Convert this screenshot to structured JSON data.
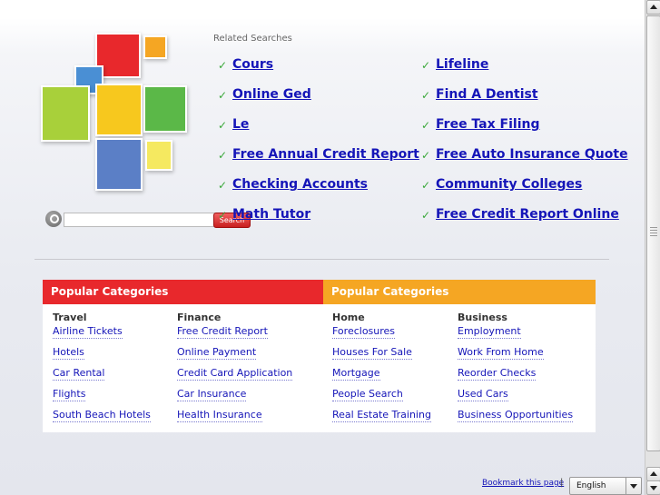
{
  "related": {
    "title": "Related Searches",
    "left": [
      "Cours",
      "Online Ged",
      "Le",
      "Free Annual Credit Report",
      "Checking Accounts",
      "Math Tutor"
    ],
    "right": [
      "Lifeline",
      "Find A Dentist",
      "Free Tax Filing",
      "Free Auto Insurance Quote",
      "Community Colleges",
      "Free Credit Report Online"
    ]
  },
  "search": {
    "button_label": "Search",
    "value": ""
  },
  "categories": [
    {
      "header": "Popular Categories",
      "color": "#e8282c",
      "columns": [
        {
          "title": "Travel",
          "links": [
            "Airline Tickets",
            "Hotels",
            "Car Rental",
            "Flights",
            "South Beach Hotels"
          ]
        },
        {
          "title": "Finance",
          "links": [
            "Free Credit Report",
            "Online Payment",
            "Credit Card Application",
            "Car Insurance",
            "Health Insurance"
          ]
        }
      ]
    },
    {
      "header": "Popular Categories",
      "color": "#f5a623",
      "columns": [
        {
          "title": "Home",
          "links": [
            "Foreclosures",
            "Houses For Sale",
            "Mortgage",
            "People Search",
            "Real Estate Training"
          ]
        },
        {
          "title": "Business",
          "links": [
            "Employment",
            "Work From Home",
            "Reorder Checks",
            "Used Cars",
            "Business Opportunities"
          ]
        }
      ]
    }
  ],
  "footer": {
    "bookmark": "Bookmark this page",
    "separator": "|",
    "language": "English"
  },
  "colors": {
    "link": "#1515b8",
    "check": "#3aa83a",
    "logo": [
      "#e8282c",
      "#f5a623",
      "#4a8fd4",
      "#a8d03a",
      "#f7c81e",
      "#5bb848",
      "#5b7fc6",
      "#f5e960"
    ]
  },
  "icons": {
    "check": "check-icon",
    "search": "magnifier-icon",
    "dropdown": "chevron-down-icon"
  }
}
